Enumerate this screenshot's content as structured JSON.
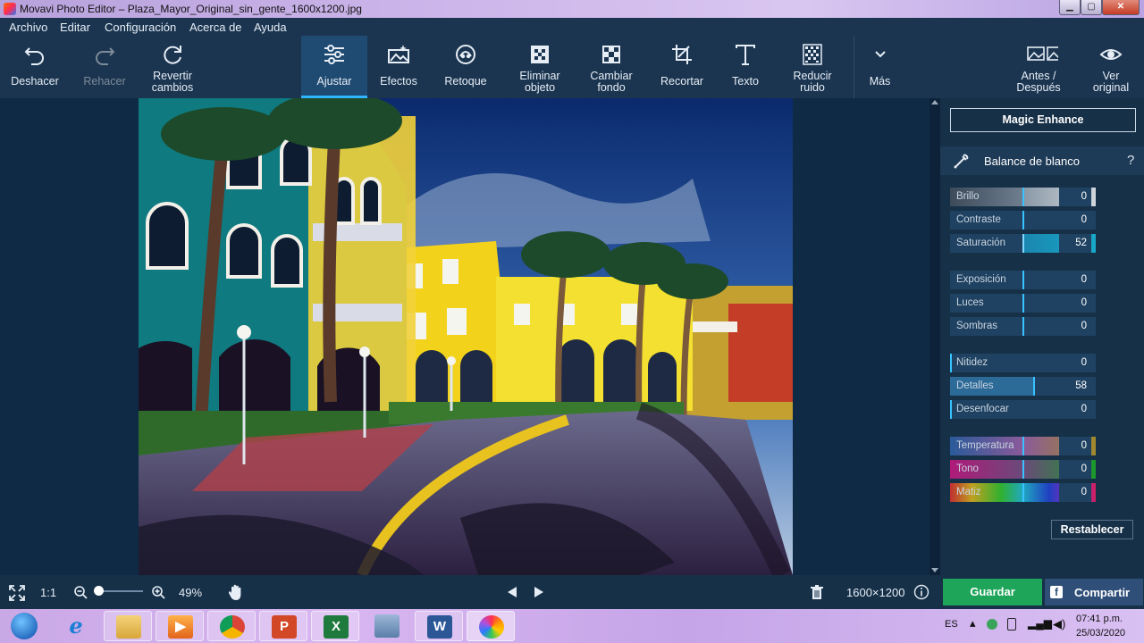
{
  "window": {
    "title": "Movavi Photo Editor – Plaza_Mayor_Original_sin_gente_1600x1200.jpg",
    "controls": {
      "minimize": "▁",
      "maximize": "▢",
      "close": "✕"
    }
  },
  "menu": [
    "Archivo",
    "Editar",
    "Configuración",
    "Acerca de",
    "Ayuda"
  ],
  "toolbar": {
    "undo": "Deshacer",
    "redo": "Rehacer",
    "revert": [
      "Revertir",
      "cambios"
    ],
    "adjust": "Ajustar",
    "effects": "Efectos",
    "retouch": "Retoque",
    "remove_object": [
      "Eliminar",
      "objeto"
    ],
    "change_bg": [
      "Cambiar",
      "fondo"
    ],
    "crop": "Recortar",
    "text": "Texto",
    "denoise": [
      "Reducir",
      "ruido"
    ],
    "more": "Más",
    "before_after": [
      "Antes /",
      "Después"
    ],
    "view_original": [
      "Ver",
      "original"
    ]
  },
  "panel": {
    "magic_enhance": "Magic Enhance",
    "white_balance": "Balance de blanco",
    "help": "?",
    "sliders": [
      {
        "label": "Brillo",
        "value": "0"
      },
      {
        "label": "Contraste",
        "value": "0"
      },
      {
        "label": "Saturación",
        "value": "52"
      },
      {
        "label": "Exposición",
        "value": "0"
      },
      {
        "label": "Luces",
        "value": "0"
      },
      {
        "label": "Sombras",
        "value": "0"
      },
      {
        "label": "Nitidez",
        "value": "0"
      },
      {
        "label": "Detalles",
        "value": "58"
      },
      {
        "label": "Desenfocar",
        "value": "0"
      },
      {
        "label": "Temperatura",
        "value": "0"
      },
      {
        "label": "Tono",
        "value": "0"
      },
      {
        "label": "Matiz",
        "value": "0"
      }
    ],
    "reset": "Restablecer"
  },
  "status": {
    "ratio": "1:1",
    "zoom": "49%",
    "zoom_fraction": 0.49,
    "image_size": "1600×1200",
    "save": "Guardar",
    "share": "Compartir",
    "share_icon": "f"
  },
  "taskbar": {
    "apps": [
      "Windows",
      "Internet Explorer",
      "Explorador",
      "Media Player",
      "Chrome",
      "PowerPoint",
      "Excel",
      "Calculadora",
      "Word",
      "Movavi Photo Editor"
    ],
    "lang": "ES",
    "time": "07:41 p.m.",
    "date": "25/03/2020"
  },
  "colors": {
    "accent": "#30b5ff",
    "save_green": "#1ea55a",
    "toolbar_bg": "#1b3550",
    "panel_bg": "#163048"
  }
}
